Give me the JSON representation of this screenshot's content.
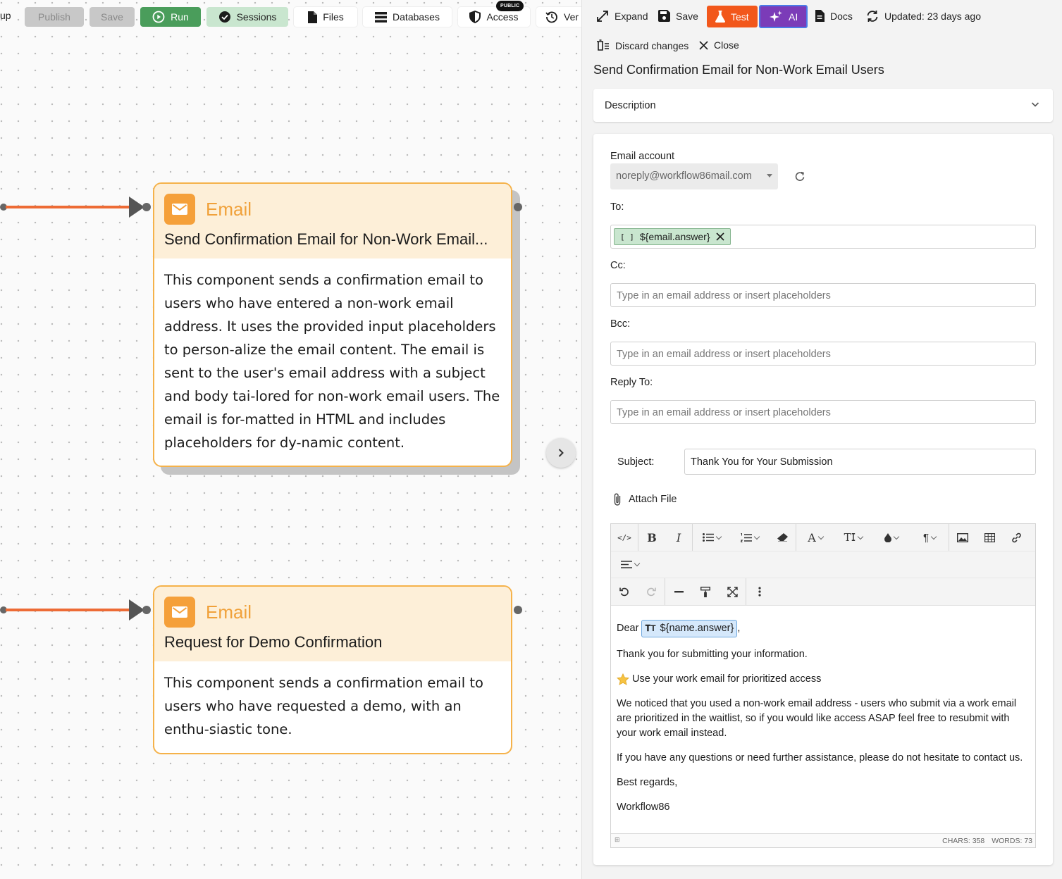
{
  "canvas": {
    "cut_label": "up",
    "toolbar": {
      "publish": "Publish",
      "save": "Save",
      "run": "Run",
      "sessions": "Sessions",
      "files": "Files",
      "databases": "Databases",
      "access": "Access",
      "access_badge": "PUBLIC",
      "versions_cut": "Ver"
    },
    "nodes": [
      {
        "type": "Email",
        "title": "Send Confirmation Email for Non-Work Email...",
        "description": "This component sends a confirmation email to users who have entered a non-work email address. It uses the provided input placeholders to person-alize the email content. The email is sent to the user's email address with a subject and body tai-lored for non-work email users. The email is for-matted in HTML and includes placeholders for dy-namic content."
      },
      {
        "type": "Email",
        "title": "Request for Demo Confirmation",
        "description": "This component sends a confirmation email to users who have requested a demo, with an enthu-siastic tone."
      }
    ]
  },
  "panel": {
    "toolbar": {
      "expand": "Expand",
      "save": "Save",
      "test": "Test",
      "ai": "AI",
      "docs": "Docs",
      "updated": "Updated: 23 days ago",
      "discard": "Discard changes",
      "close": "Close"
    },
    "title": "Send Confirmation Email for Non-Work Email Users",
    "description_label": "Description",
    "form": {
      "email_account_label": "Email account",
      "email_account_value": "noreply@workflow86mail.com",
      "to_label": "To:",
      "to_chip": "${email.answer}",
      "to_chip_icon": "[ ]",
      "cc_label": "Cc:",
      "bcc_label": "Bcc:",
      "reply_to_label": "Reply To:",
      "placeholder": "Type in an email address or insert placeholders",
      "subject_label": "Subject:",
      "subject_value": "Thank You for Your Submission",
      "attach_label": "Attach File"
    },
    "editor": {
      "dear": "Dear",
      "name_placeholder": "${name.answer}",
      "line1": "Thank you for submitting your information.",
      "line2": "Use your work email for prioritized access",
      "line3": "We noticed that you used a non-work email address - users who submit via a work email are prioritized in the waitlist, so if you would like access ASAP feel free to resubmit with your work email instead.",
      "line4": "If you have any questions or need further assistance, please do not hesitate to contact us.",
      "line5": "Best regards,",
      "line6": "Workflow86",
      "chars": "CHARS: 358",
      "words": "WORDS: 73"
    }
  },
  "colors": {
    "edge": "#ed6b35",
    "node_border": "#f5b24a",
    "node_header": "#fdefd8",
    "run_green": "#4a9d5b",
    "test_orange": "#f2571b",
    "ai_purple": "#7b3bb8"
  }
}
